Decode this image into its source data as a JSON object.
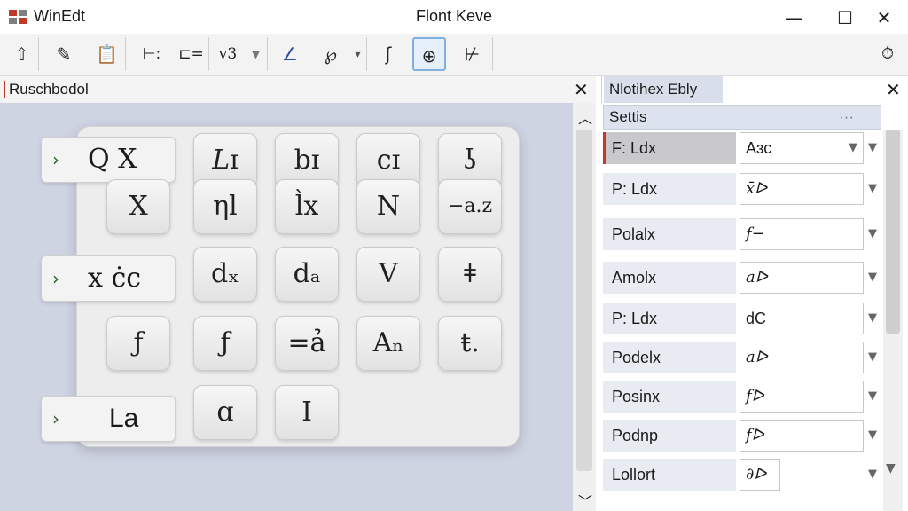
{
  "window": {
    "app_name": "WinEdt",
    "title": "Flont Keve",
    "min_glyph": "—",
    "max_glyph": "☐",
    "close_glyph": "✕"
  },
  "toolbar": {
    "items": [
      {
        "icon": "up-arrow-icon",
        "glyph": "⇧"
      },
      {
        "icon": "edit-icon",
        "glyph": "✎"
      },
      {
        "icon": "clipboard-icon",
        "glyph": "📋"
      },
      {
        "icon": "indent-icon",
        "glyph": "⊢:"
      },
      {
        "icon": "column-icon",
        "glyph": "⊏="
      },
      {
        "icon": "v3-label",
        "glyph": "v3"
      },
      {
        "icon": "dropdown-icon",
        "glyph": "▼"
      },
      {
        "icon": "slash-icon",
        "glyph": "∠"
      },
      {
        "icon": "script-icon",
        "glyph": "℘"
      },
      {
        "icon": "dropdown-icon",
        "glyph": "▾"
      },
      {
        "icon": "integral-icon",
        "glyph": "ʃ"
      },
      {
        "icon": "globe-icon",
        "glyph": "⊕"
      },
      {
        "icon": "tool-icon",
        "glyph": "⊬"
      },
      {
        "icon": "timer-icon",
        "glyph": "⏱"
      }
    ]
  },
  "left_panel": {
    "title": "Ruschbodol",
    "close_glyph": "✕",
    "rows": [
      {
        "chevron": "›",
        "label": "Q  X"
      },
      {
        "chevron": "›",
        "label": "x  ċc"
      },
      {
        "chevron": "›",
        "label": "La"
      }
    ],
    "symbols": [
      "𝐿ɪ",
      "bɪ",
      "cɪ",
      "ʖ",
      "X",
      "ηl",
      "l̀x",
      "N",
      "−a.z",
      "dₓ",
      "dₐ",
      "V",
      "ǂ",
      "ƒ",
      "ƒ",
      "=ả",
      "Aₙ",
      "ŧ.",
      "ɑ",
      "I"
    ]
  },
  "right_panel": {
    "title": "Nlotihex Ebly",
    "close_glyph": "✕",
    "section": "Settis",
    "section_dots": "···",
    "properties": [
      {
        "name": "F: Ldx",
        "value": "Aɜc"
      },
      {
        "name": "P: Ldx",
        "value": "x̄ᐅ"
      },
      {
        "name": "Polalx",
        "value": "f−"
      },
      {
        "name": "Amolx",
        "value": "aᐅ"
      },
      {
        "name": "P: Ldx",
        "value": "dC"
      },
      {
        "name": "Podelx",
        "value": "aᐅ"
      },
      {
        "name": "Posinx",
        "value": "fᐅ"
      },
      {
        "name": "Podnp",
        "value": "fᐅ"
      },
      {
        "name": "Lollort",
        "value": "∂ᐅ"
      }
    ]
  },
  "colors": {
    "canvas": "#cfd4e3",
    "panel_header": "#d9dfea",
    "accent_red": "#c0392b",
    "active_border": "#7fb0e0"
  }
}
